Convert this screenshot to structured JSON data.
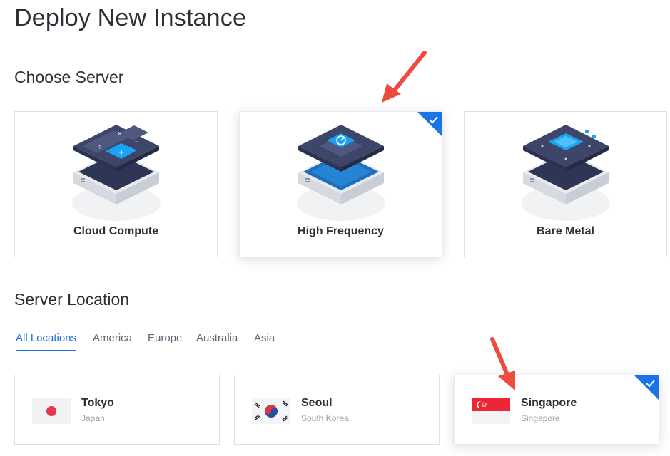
{
  "page": {
    "title": "Deploy New Instance"
  },
  "server_section": {
    "title": "Choose Server",
    "cards": [
      {
        "label": "Cloud Compute",
        "icon": "calculator-server-icon",
        "selected": false
      },
      {
        "label": "High Frequency",
        "icon": "speed-chip-server-icon",
        "selected": true
      },
      {
        "label": "Bare Metal",
        "icon": "circuit-board-server-icon",
        "selected": false
      }
    ]
  },
  "location_section": {
    "title": "Server Location",
    "tabs": [
      {
        "label": "All Locations",
        "active": true
      },
      {
        "label": "America",
        "active": false
      },
      {
        "label": "Europe",
        "active": false
      },
      {
        "label": "Australia",
        "active": false
      },
      {
        "label": "Asia",
        "active": false
      }
    ],
    "locations": [
      {
        "city": "Tokyo",
        "country": "Japan",
        "flag": "japan-flag-icon",
        "selected": false
      },
      {
        "city": "Seoul",
        "country": "South Korea",
        "flag": "south-korea-flag-icon",
        "selected": false
      },
      {
        "city": "Singapore",
        "country": "Singapore",
        "flag": "singapore-flag-icon",
        "selected": true
      }
    ]
  },
  "colors": {
    "accent": "#1e6fe8",
    "check_blue": "#1b73e8",
    "arrow_red": "#ec4b3e",
    "chip_blue": "#1aa3f5",
    "chip_dark": "#3b4466"
  }
}
